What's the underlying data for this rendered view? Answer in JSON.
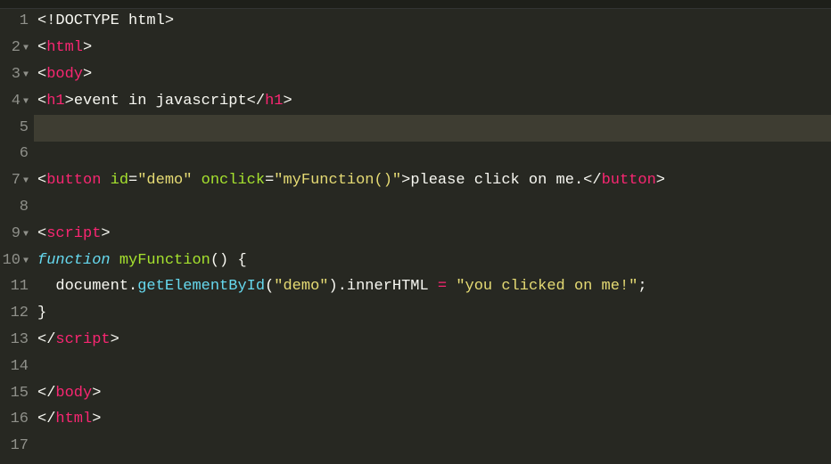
{
  "editor": {
    "activeLine": 5,
    "totalLines": 17,
    "foldableLines": [
      2,
      3,
      4,
      7,
      9,
      10
    ],
    "lineNumbers": [
      "1",
      "2",
      "3",
      "4",
      "5",
      "6",
      "7",
      "8",
      "9",
      "10",
      "11",
      "12",
      "13",
      "14",
      "15",
      "16",
      "17"
    ]
  },
  "code": {
    "l1": {
      "doctype": "<!DOCTYPE html>"
    },
    "l2": {
      "open": "<",
      "tag": "html",
      "close": ">"
    },
    "l3": {
      "open": "<",
      "tag": "body",
      "close": ">"
    },
    "l4": {
      "open": "<",
      "tag": "h1",
      "close1": ">",
      "text": "event in javascript",
      "endopen": "</",
      "endtag": "h1",
      "endclose": ">"
    },
    "l7": {
      "open": "<",
      "tag": "button",
      "sp1": " ",
      "attr1": "id",
      "eq1": "=",
      "val1": "\"demo\"",
      "sp2": " ",
      "attr2": "onclick",
      "eq2": "=",
      "val2": "\"myFunction()\"",
      "close1": ">",
      "text": "please click on me.",
      "endopen": "</",
      "endtag": "button",
      "endclose": ">"
    },
    "l9": {
      "open": "<",
      "tag": "script",
      "close": ">"
    },
    "l10": {
      "kw": "function",
      "sp": " ",
      "name": "myFunction",
      "parens": "()",
      "sp2": " ",
      "brace": "{"
    },
    "l11": {
      "indent": "  ",
      "obj": "document",
      "dot1": ".",
      "m1": "getElementById",
      "p1": "(",
      "arg1": "\"demo\"",
      "p2": ")",
      "dot2": ".",
      "prop": "innerHTML",
      "sp1": " ",
      "op": "=",
      "sp2": " ",
      "val": "\"you clicked on me!\"",
      "semi": ";"
    },
    "l12": {
      "brace": "}"
    },
    "l13": {
      "open": "</",
      "tag": "script",
      "close": ">"
    },
    "l15": {
      "open": "</",
      "tag": "body",
      "close": ">"
    },
    "l16": {
      "open": "</",
      "tag": "html",
      "close": ">"
    }
  }
}
